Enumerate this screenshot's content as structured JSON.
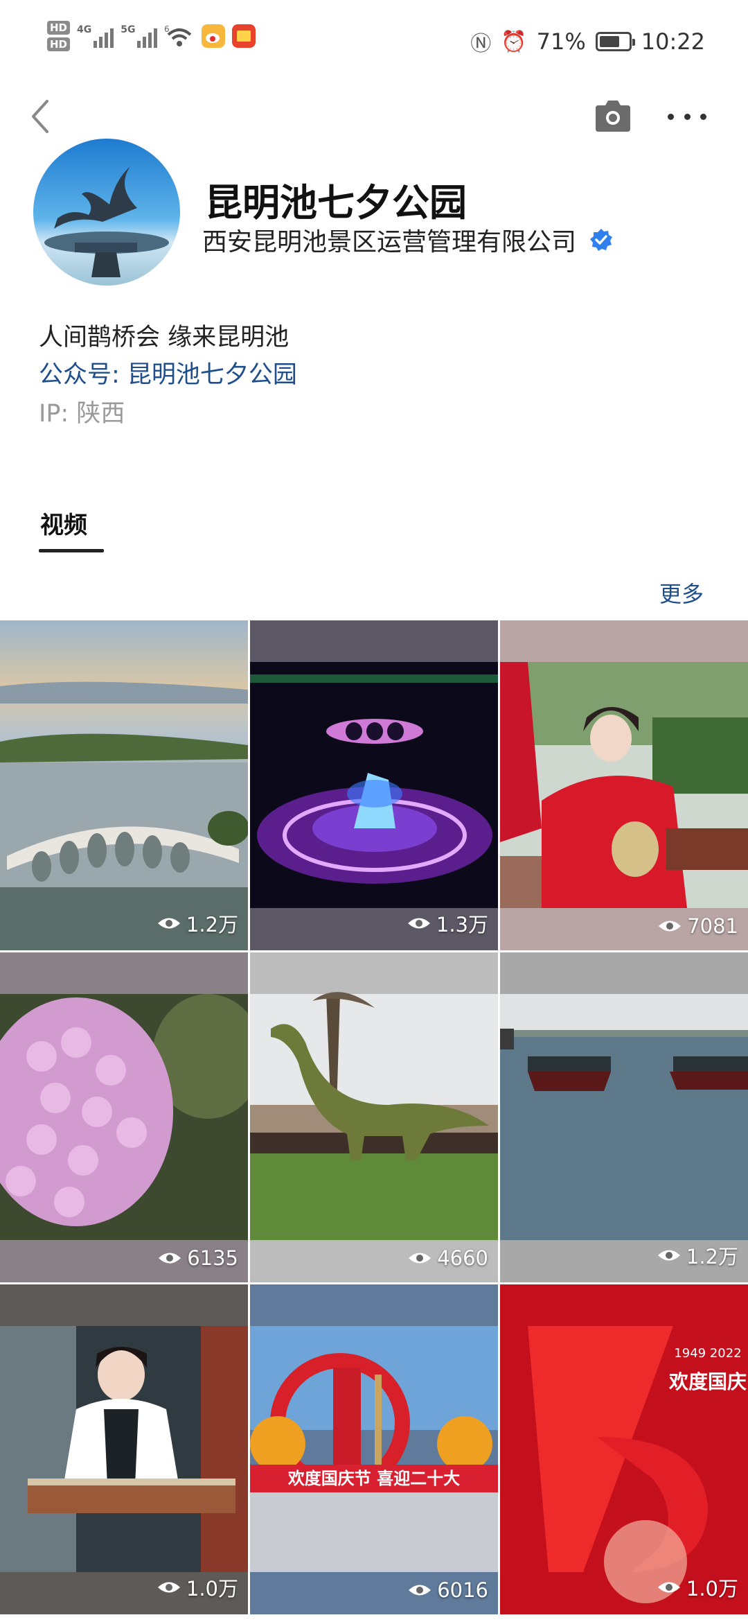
{
  "status_bar": {
    "hd1": "HD",
    "hd2": "HD",
    "net1": "4G",
    "net2": "5G",
    "wifi_label": "6",
    "battery_percent": "71%",
    "battery_level": 0.71,
    "time": "10:22"
  },
  "nav": {
    "back_icon": "chevron-left-icon",
    "camera_icon": "camera-icon",
    "more_icon": "more-horizontal-icon"
  },
  "profile": {
    "name": "昆明池七夕公园",
    "company": "西安昆明池景区运营管理有限公司",
    "bio": "人间鹊桥会 缘来昆明池",
    "public_account": "公众号: 昆明池七夕公园",
    "ip": "IP: 陕西"
  },
  "tabs": [
    {
      "label": "视频"
    }
  ],
  "more_link": "更多",
  "videos": [
    {
      "views": "1.2万"
    },
    {
      "views": "1.3万"
    },
    {
      "views": "7081"
    },
    {
      "views": "6135"
    },
    {
      "views": "4660"
    },
    {
      "views": "1.2万"
    },
    {
      "views": "1.0万"
    },
    {
      "views": "6016"
    },
    {
      "views": "1.0万"
    }
  ],
  "video_text": {
    "v8_banner": "欢度国庆节 喜迎二十大",
    "v9_years": "1949 2022",
    "v9_title": "欢度国庆"
  },
  "colors": {
    "link_blue": "#1f4e8c",
    "verify_blue": "#2f80ed",
    "muted_gray": "#9a9a9a"
  }
}
